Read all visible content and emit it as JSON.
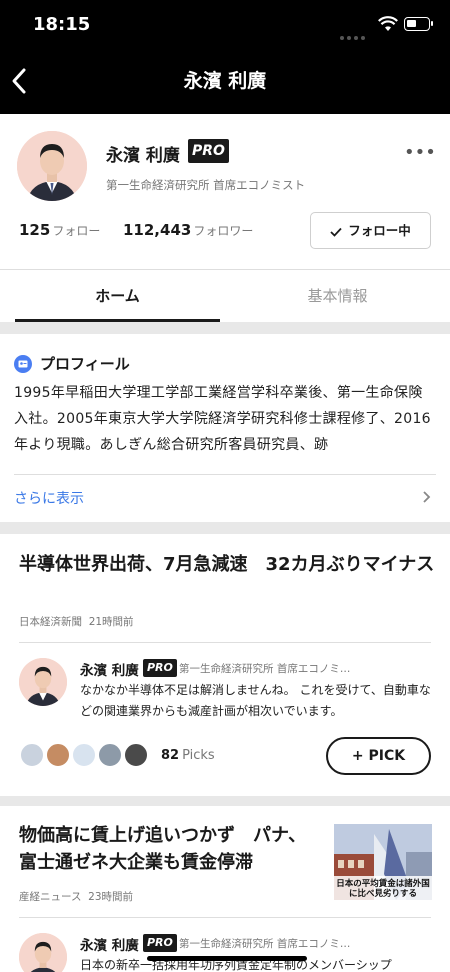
{
  "status_bar": {
    "time": "18:15"
  },
  "nav": {
    "title": "永濱 利廣"
  },
  "profile": {
    "name": "永濱 利廣",
    "pro_badge": "PRO",
    "affiliation": "第一生命経済研究所 首席エコノミスト",
    "follow_count": "125",
    "follow_label": "フォロー",
    "follower_count": "112,443",
    "follower_label": "フォロワー",
    "follow_button": "フォロー中",
    "more_menu": "•••"
  },
  "tabs": [
    {
      "label": "ホーム",
      "active": true
    },
    {
      "label": "基本情報",
      "active": false
    }
  ],
  "profile_card": {
    "header": "プロフィール",
    "body": "1995年早稲田大学理工学部工業経営学科卒業後、第一生命保険入社。2005年東京大学大学院経済学研究科修士課程修了、2016年より現職。あしぎん総合研究所客員研究員、跡",
    "show_more": "さらに表示"
  },
  "articles": [
    {
      "headline": "半導体世界出荷、7月急減速　32カ月ぶりマイナス",
      "source": "日本経済新聞",
      "time": "21時間前",
      "comment": {
        "name": "永濱 利廣",
        "pro_badge": "PRO",
        "affiliation": "第一生命経済研究所 首席エコノミ…",
        "text": "なかなか半導体不足は解消しませんね。 これを受けて、自動車などの関連業界からも減産計画が相次いでいます。"
      },
      "picks_count": "82",
      "picks_label": "Picks",
      "pick_button": "+ PICK"
    },
    {
      "headline": "物価高に賃上げ追いつかず　パナ、富士通ゼネ大企業も賃金停滞",
      "source": "産経ニュース",
      "time": "23時間前",
      "thumbnail_caption": "日本の平均賃金は諸外国に比べ見劣りする",
      "comment": {
        "name": "永濱 利廣",
        "pro_badge": "PRO",
        "affiliation": "第一生命経済研究所 首席エコノミ…",
        "text": "日本の新卒一括採用年功序列賃金定年制のメンバーシップ"
      }
    }
  ],
  "colors": {
    "accent_blue": "#3a78e6",
    "header_bg": "#000000",
    "band_gray": "#e8e8e8"
  }
}
